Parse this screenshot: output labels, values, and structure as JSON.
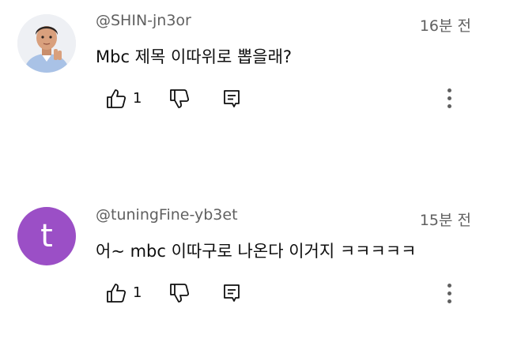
{
  "comments": [
    {
      "username": "@SHIN-jn3or",
      "timestamp": "16분 전",
      "text": "Mbc 제목 이따위로 뽑을래?",
      "like_count": "1",
      "avatar": {
        "type": "photo",
        "background": "#eef0f4"
      }
    },
    {
      "username": "@tuningFine-yb3et",
      "timestamp": "15분 전",
      "text": "어~ mbc 이따구로 나온다 이거지 ㅋㅋㅋㅋㅋ",
      "like_count": "1",
      "avatar": {
        "type": "letter",
        "letter": "t",
        "background": "#9b4fc6"
      }
    }
  ],
  "icons": {
    "like": "thumb-up-icon",
    "dislike": "thumb-down-icon",
    "reply": "reply-icon",
    "more": "more-vert-icon"
  },
  "colors": {
    "secondary_text": "#606060",
    "primary_text": "#0f0f0f",
    "background": "#ffffff"
  }
}
